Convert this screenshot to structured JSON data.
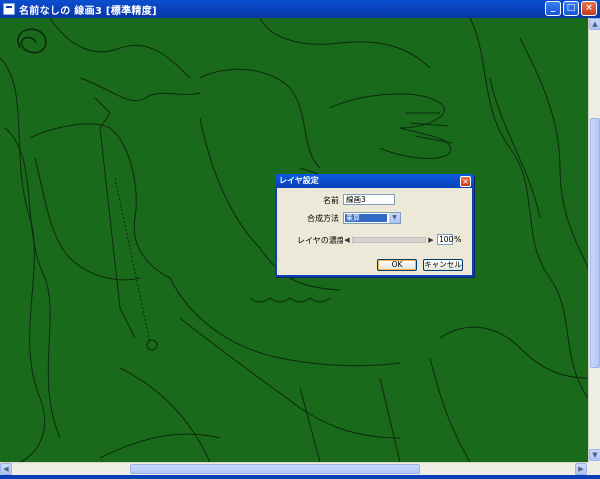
{
  "window": {
    "title": "名前なしの 線画3 [標準精度]",
    "minimize_glyph": "_",
    "maximize_glyph": "□",
    "close_glyph": "×"
  },
  "dialog": {
    "title": "レイヤ設定",
    "close_glyph": "×",
    "name_label": "名前",
    "name_value": "線画3",
    "blend_label": "合成方法",
    "blend_value": "乗算",
    "opacity_label": "レイヤの濃度",
    "opacity_value": "100",
    "opacity_unit": "%",
    "opacity_fraction": 1.0,
    "ok_label": "OK",
    "cancel_label": "キャンセル"
  },
  "scrollbars": {
    "up": "▲",
    "down": "▼",
    "left": "◀",
    "right": "▶"
  },
  "colors": {
    "canvas_bg": "#1a6a1c",
    "line": "#0d2a0e",
    "titlebar": "#0a3fb8"
  }
}
